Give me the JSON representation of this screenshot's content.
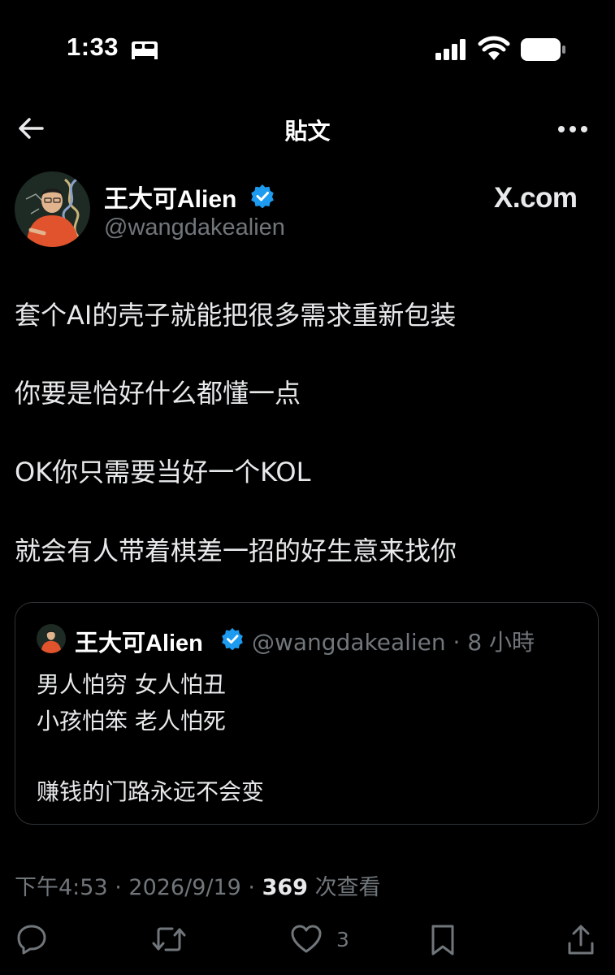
{
  "status_bar": {
    "time": "1:33"
  },
  "header": {
    "title": "貼文"
  },
  "author": {
    "name": "王大可Alien",
    "handle": "@wangdakealien",
    "watermark": "X.com"
  },
  "post": {
    "lines": [
      "套个AI的壳子就能把很多需求重新包装",
      "你要是恰好什么都懂一点",
      "OK你只需要当好一个KOL",
      "就会有人带着棋差一招的好生意来找你"
    ]
  },
  "quote": {
    "name": "王大可Alien",
    "meta": "@wangdakealien · 8 小時",
    "lines": [
      "男人怕穷 女人怕丑",
      "小孩怕笨 老人怕死",
      "赚钱的门路永远不会变"
    ]
  },
  "meta": {
    "time": "下午4:53",
    "date": "2026/9/19",
    "views": "369",
    "views_label": "次查看"
  },
  "actions": {
    "like_count": "3"
  },
  "colors": {
    "background": "#000000",
    "text": "#e7e9ea",
    "secondary": "#71767b",
    "verified": "#1d9bf0",
    "border": "#2f3336"
  }
}
